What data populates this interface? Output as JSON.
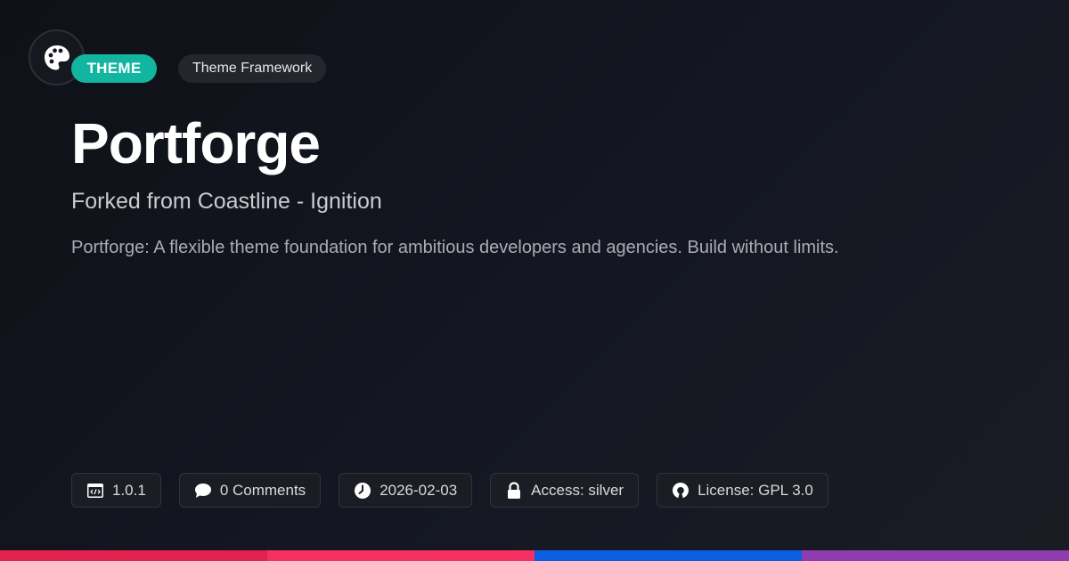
{
  "header": {
    "logo_icon": "palette-icon",
    "category_badge": "THEME",
    "category_color": "#12b5a0",
    "tag": "Theme Framework"
  },
  "main": {
    "title": "Portforge",
    "subtitle": "Forked from Coastline - Ignition",
    "description": "Portforge: A flexible theme foundation for ambitious developers and agencies. Build without limits."
  },
  "meta": {
    "version": {
      "icon": "code-window-icon",
      "text": "1.0.1"
    },
    "comments": {
      "icon": "comment-bubble-icon",
      "text": "0 Comments"
    },
    "date": {
      "icon": "clock-icon",
      "text": "2026-02-03"
    },
    "access": {
      "icon": "lock-icon",
      "text": "Access: silver"
    },
    "license": {
      "icon": "open-source-icon",
      "text": "License: GPL 3.0"
    }
  },
  "accent_bar": {
    "colors": [
      "#e0234e",
      "#f43162",
      "#0a5ee0",
      "#8e3cae"
    ]
  }
}
